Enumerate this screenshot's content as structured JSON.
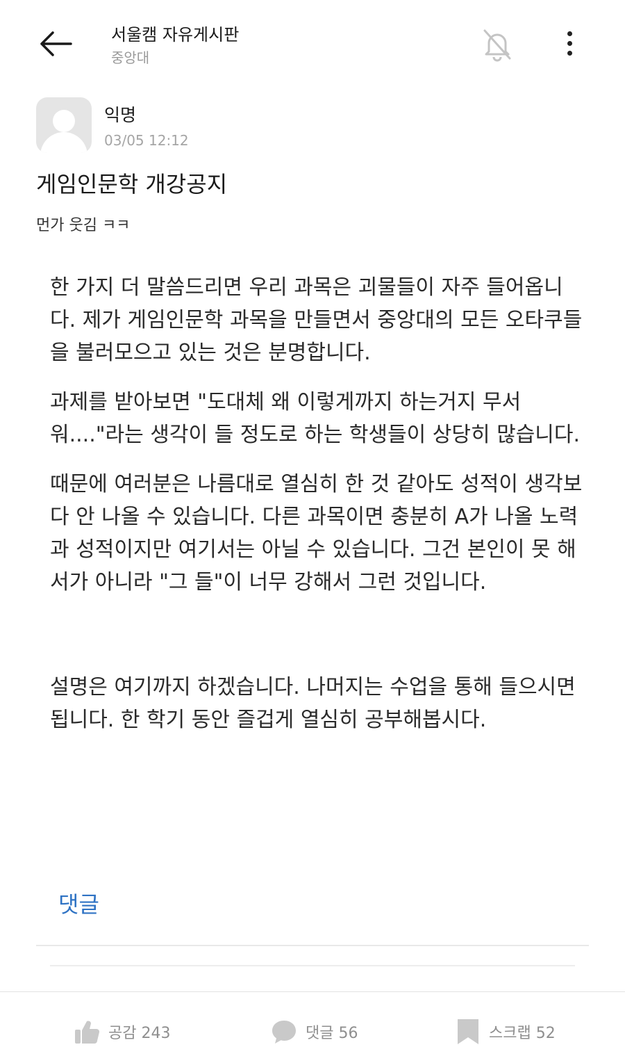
{
  "header": {
    "title": "서울캠 자유게시판",
    "subtitle": "중앙대"
  },
  "post": {
    "author": "익명",
    "timestamp": "03/05 12:12",
    "title": "게임인문학 개강공지",
    "body": "먼가 웃김 ㅋㅋ"
  },
  "content": {
    "p1": "한 가지 더 말씀드리면 우리 과목은 괴물들이 자주 들어옵니다. 제가 게임인문학 과목을 만들면서 중앙대의 모든 오타쿠들을 불러모으고 있는 것은 분명합니다.",
    "p2": "과제를 받아보면 \"도대체 왜 이렇게까지 하는거지 무서워....\"라는 생각이 들 정도로 하는 학생들이 상당히 많습니다.",
    "p3": "때문에 여러분은 나름대로 열심히 한 것 같아도 성적이 생각보다 안 나올 수 있습니다. 다른 과목이면 충분히 A가 나올 노력과 성적이지만 여기서는 아닐 수 있습니다. 그건 본인이 못 해서가 아니라 \"그 들\"이 너무 강해서 그런 것입니다.",
    "p4": "설명은 여기까지 하겠습니다. 나머지는 수업을 통해 들으시면 됩니다. 한 학기 동안 즐겁게 열심히 공부해봅시다."
  },
  "comment_link": "댓글",
  "actions": {
    "like_label": "공감 243",
    "comment_label": "댓글 56",
    "scrap_label": "스크랩 52"
  },
  "icons": {
    "back": "arrow-left-icon",
    "bell": "bell-off-icon",
    "more": "more-vertical-icon",
    "like": "thumbs-up-icon",
    "comment": "speech-bubble-icon",
    "scrap": "bookmark-icon"
  },
  "colors": {
    "accent": "#2f73c4",
    "muted": "#9a9a9a"
  }
}
